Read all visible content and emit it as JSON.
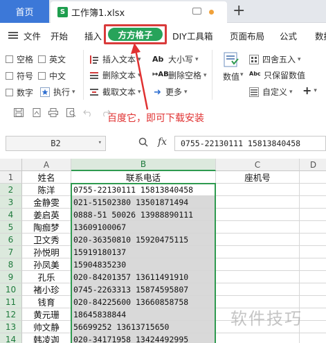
{
  "tabs": {
    "home": "首页",
    "document": "工作簿1.xlsx",
    "doc_icon_letter": "S"
  },
  "menu": {
    "file": "文件",
    "items": [
      "开始",
      "插入",
      "方方格子",
      "DIY工具箱",
      "页面布局",
      "公式",
      "数据"
    ]
  },
  "ribbon": {
    "checkboxes": [
      "空格",
      "英文",
      "符号",
      "中文",
      "数字"
    ],
    "execute": "执行",
    "text_ops": [
      "插入文本",
      "删除文本",
      "截取文本"
    ],
    "case_ops": [
      "大小写",
      "删除空格",
      "更多"
    ],
    "value": "数值",
    "rounding": "四舍五入",
    "keep_value": "只保留数值",
    "custom": "自定义",
    "plus": "+"
  },
  "annotation": "百度它，即可下载安装",
  "formula_bar": {
    "name_box": "B2",
    "fx": "fx",
    "formula": "0755-22130111 15813840458"
  },
  "grid": {
    "columns": [
      "A",
      "B",
      "C",
      "D"
    ],
    "rows": [
      {
        "num": "1",
        "name": "姓名",
        "phone": "联系电话",
        "landline": "座机号"
      },
      {
        "num": "2",
        "name": "陈洋",
        "phone": "0755-22130111 15813840458",
        "landline": ""
      },
      {
        "num": "3",
        "name": "金静雯",
        "phone": "021-51502380 13501871494",
        "landline": ""
      },
      {
        "num": "4",
        "name": "姜启英",
        "phone": "0888-51 50026 13988890111",
        "landline": ""
      },
      {
        "num": "5",
        "name": "陶痂梦",
        "phone": "13609100067",
        "landline": ""
      },
      {
        "num": "6",
        "name": "卫文秀",
        "phone": "020-36350810 15920475115",
        "landline": ""
      },
      {
        "num": "7",
        "name": "孙悦明",
        "phone": "15919180137",
        "landline": ""
      },
      {
        "num": "8",
        "name": "孙凤美",
        "phone": "15904835230",
        "landline": ""
      },
      {
        "num": "9",
        "name": "孔乐",
        "phone": "020-84201357 13611491910",
        "landline": ""
      },
      {
        "num": "10",
        "name": "褚小珍",
        "phone": "0745-2263313 15874595807",
        "landline": ""
      },
      {
        "num": "11",
        "name": "钱育",
        "phone": "020-84225600 13660858758",
        "landline": ""
      },
      {
        "num": "12",
        "name": "黄元珊",
        "phone": "18645838844",
        "landline": ""
      },
      {
        "num": "13",
        "name": "帅文静",
        "phone": "56699252 13613715650",
        "landline": ""
      },
      {
        "num": "14",
        "name": "韩凌迦",
        "phone": "020-34171958 13424492995",
        "landline": ""
      }
    ]
  },
  "watermark": "软件技巧",
  "colors": {
    "accent_green": "#27a35a",
    "highlight_red": "#d93a3a",
    "home_tab_blue": "#3c78d8"
  }
}
